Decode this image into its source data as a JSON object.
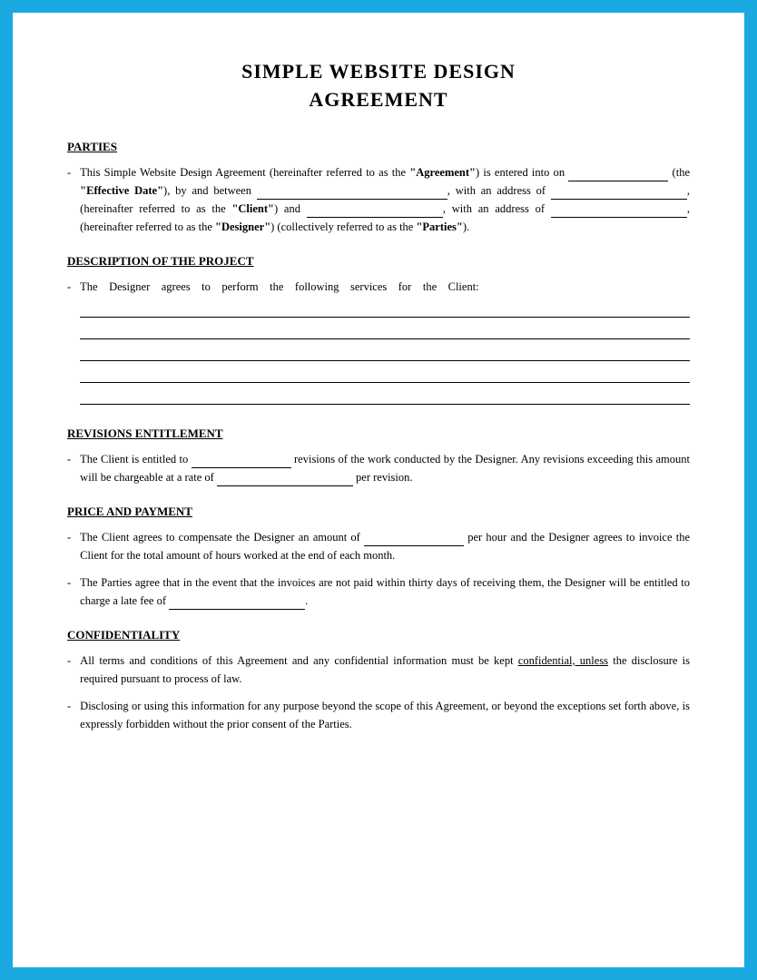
{
  "page": {
    "border_color": "#1aa8e0",
    "background": "#ffffff"
  },
  "title": {
    "line1": "SIMPLE WEBSITE DESIGN",
    "line2": "AGREEMENT"
  },
  "sections": {
    "parties": {
      "heading": "PARTIES",
      "bullet1": {
        "intro": "This Simple Website Design Agreement (hereinafter referred to as the ",
        "agreement_bold": "“Agreement”",
        "mid1": ") is entered into on",
        "blank1_type": "short",
        "(the": "(the",
        "effective_bold": "“Effective Date”",
        "mid2": "), by and between",
        "blank2_type": "xlong",
        "mid3": ", with an address of",
        "blank3_type": "medium",
        "mid4": ", (hereinafter referred to as the",
        "client_bold": "“Client”",
        "mid5": ") and",
        "blank4_type": "medium",
        "mid6": ", with an address of",
        "blank5_type": "medium",
        "mid7": ", (hereinafter referred to as the",
        "designer_bold": "“Designer”",
        "mid8": ") (collectively referred to as the",
        "parties_bold": "“Parties”",
        "end": ")."
      }
    },
    "description": {
      "heading": "DESCRIPTION OF THE PROJECT",
      "bullet1": {
        "text": "The   Designer   agrees   to   perform   the   following   services   for   the   Client:"
      }
    },
    "revisions": {
      "heading": "REVISIONS ENTITLEMENT",
      "bullet1_start": "The Client is entitled to",
      "bullet1_mid": "revisions of the work conducted by the Designer. Any revisions exceeding this amount will be chargeable at a rate of",
      "bullet1_end": "per revision."
    },
    "price": {
      "heading": "PRICE AND PAYMENT",
      "bullet1_start": "The Client agrees to compensate the Designer an amount of",
      "bullet1_mid": "per hour and the Designer agrees to invoice the Client for the total amount of hours worked at the end of each month.",
      "bullet2_start": "The Parties agree that in the event that the invoices are not paid within thirty days of receiving them, the Designer will be entitled to charge a late fee of",
      "bullet2_end": "."
    },
    "confidentiality": {
      "heading": "CONFIDENTIALITY",
      "bullet1_start": "All terms and conditions of this Agreement and any confidential information must be kept",
      "bullet1_underline": "confidential, unless",
      "bullet1_end": "the disclosure is required pursuant to process of law.",
      "bullet2": "Disclosing or using this information for any purpose beyond the scope of this Agreement, or beyond the exceptions set forth above, is expressly forbidden without the prior consent of the Parties."
    }
  }
}
